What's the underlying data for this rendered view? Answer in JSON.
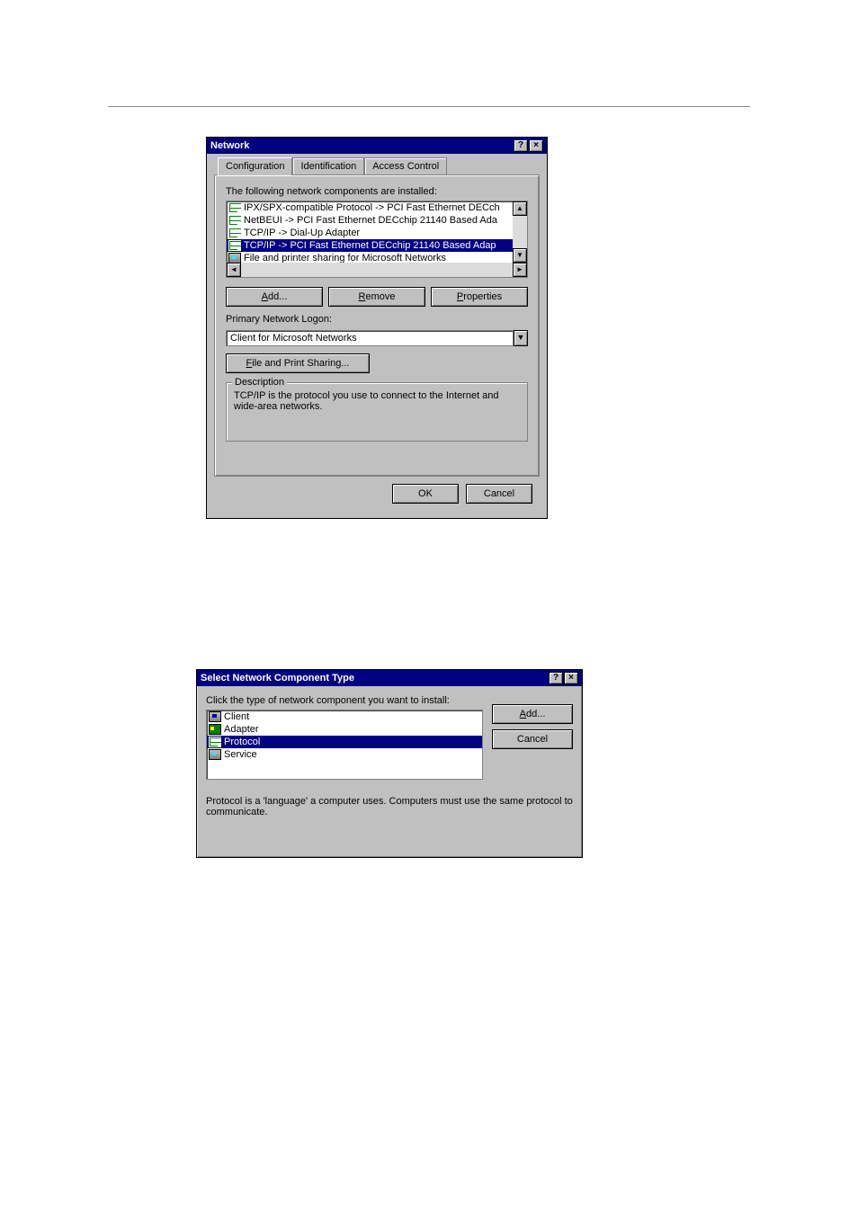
{
  "dialog1": {
    "title": "Network",
    "helpGlyph": "?",
    "closeGlyph": "×",
    "tabs": [
      "Configuration",
      "Identification",
      "Access Control"
    ],
    "activeTab": 0,
    "componentsLabel": "The following network components are installed:",
    "components": [
      {
        "type": "protocol",
        "text": "IPX/SPX-compatible Protocol -> PCI Fast Ethernet DECch",
        "selected": false
      },
      {
        "type": "protocol",
        "text": "NetBEUI -> PCI Fast Ethernet DECchip 21140 Based Ada",
        "selected": false
      },
      {
        "type": "protocol",
        "text": "TCP/IP -> Dial-Up Adapter",
        "selected": false
      },
      {
        "type": "protocol",
        "text": "TCP/IP -> PCI Fast Ethernet DECchip 21140 Based Adap",
        "selected": true
      },
      {
        "type": "service",
        "text": "File and printer sharing for Microsoft Networks",
        "selected": false
      }
    ],
    "scroll": {
      "up": "▲",
      "down": "▼",
      "left": "◄",
      "right": "►"
    },
    "buttons": {
      "add": "Add...",
      "remove": "Remove",
      "properties": "Properties"
    },
    "primaryLabel": "Primary Network Logon:",
    "primaryValue": "Client for Microsoft Networks",
    "fileShareBtn": "File and Print Sharing...",
    "descriptionLabel": "Description",
    "descriptionText": "TCP/IP is the protocol you use to connect to the Internet and wide-area networks.",
    "ok": "OK",
    "cancel": "Cancel"
  },
  "dialog2": {
    "title": "Select Network Component Type",
    "helpGlyph": "?",
    "closeGlyph": "×",
    "promptLabel": "Click the type of network component you want to install:",
    "items": [
      {
        "type": "client",
        "text": "Client",
        "selected": false
      },
      {
        "type": "adapter",
        "text": "Adapter",
        "selected": false
      },
      {
        "type": "protocol",
        "text": "Protocol",
        "selected": true
      },
      {
        "type": "service",
        "text": "Service",
        "selected": false
      }
    ],
    "addBtn": "Add...",
    "cancelBtn": "Cancel",
    "description": "Protocol is a 'language' a computer uses. Computers must use the same protocol to communicate."
  }
}
